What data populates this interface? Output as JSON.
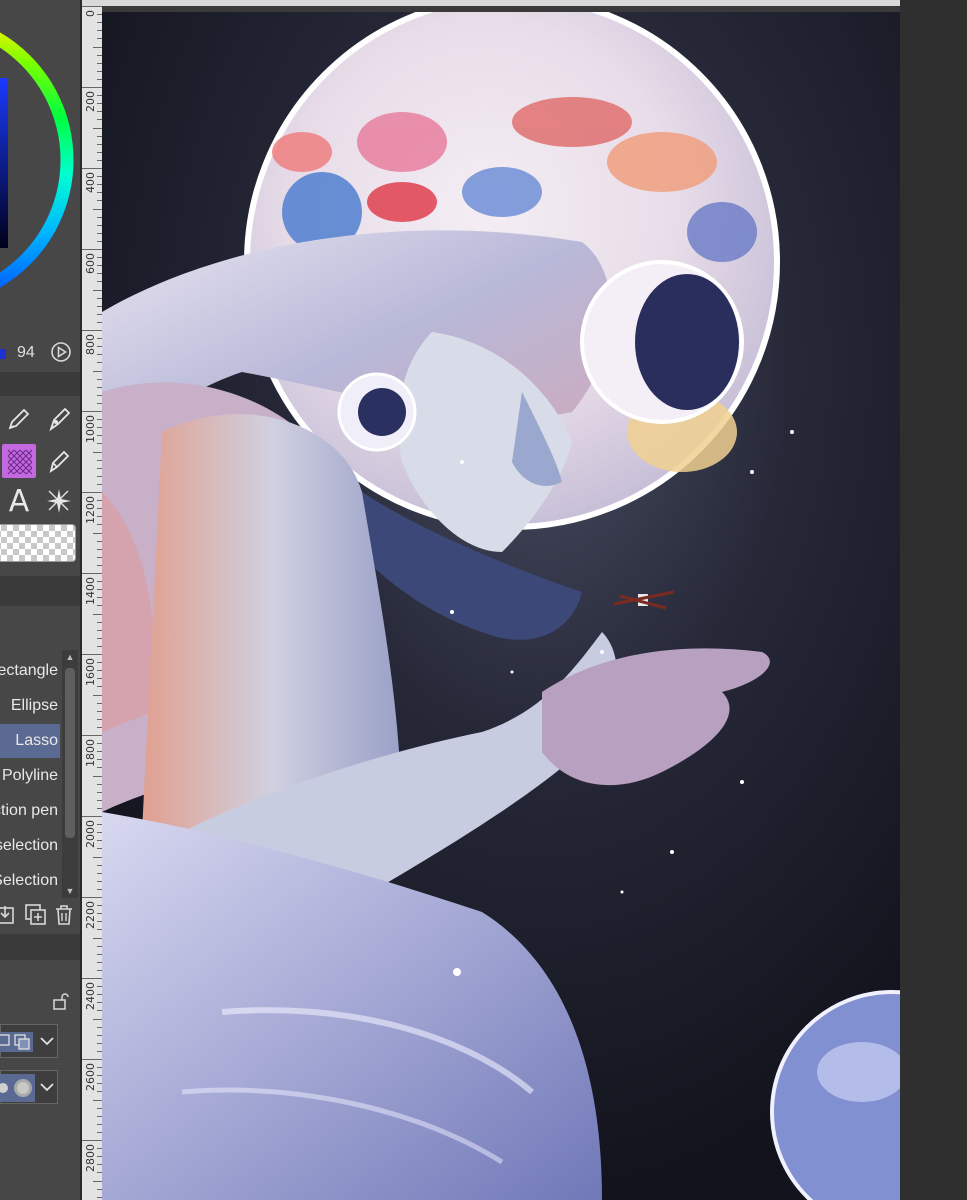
{
  "color_panel": {
    "hsv_value": "94",
    "current_color": "#1c32d6"
  },
  "tools": [
    {
      "icon": "pen-nib-icon"
    },
    {
      "icon": "pen-fill-icon"
    },
    {
      "icon": "grid-pattern-icon",
      "active": true
    },
    {
      "icon": "marker-pen-icon"
    },
    {
      "icon": "text-tool-icon",
      "label": "A"
    },
    {
      "icon": "sparkle-effect-icon"
    }
  ],
  "sub_tools": [
    {
      "label": "Rectangle",
      "active": false
    },
    {
      "label": "Ellipse",
      "active": false
    },
    {
      "label": "Lasso",
      "active": true
    },
    {
      "label": "Polyline",
      "active": false
    },
    {
      "label": "Selection pen",
      "active": false
    },
    {
      "label": "Shrink selection",
      "active": false
    },
    {
      "label": "Selection",
      "active": false
    }
  ],
  "ruler": {
    "labels": [
      "0",
      "200",
      "400",
      "600",
      "800",
      "1000",
      "1200",
      "1400",
      "1600",
      "1800",
      "2000",
      "2200",
      "2400",
      "2600",
      "2800"
    ]
  },
  "colors": {
    "panel_bg": "#474747",
    "active_item": "#5a6a92",
    "canvas_bg": "#1e2030"
  }
}
